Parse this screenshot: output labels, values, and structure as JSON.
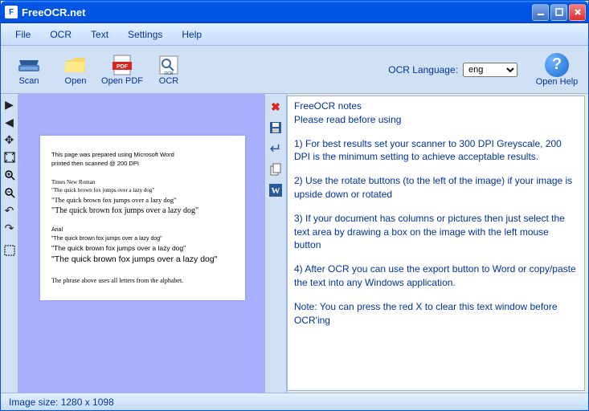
{
  "window": {
    "title": "FreeOCR.net"
  },
  "menu": {
    "file": "File",
    "ocr": "OCR",
    "text": "Text",
    "settings": "Settings",
    "help": "Help"
  },
  "toolbar": {
    "scan": "Scan",
    "open": "Open",
    "open_pdf": "Open PDF",
    "ocr": "OCR"
  },
  "lang": {
    "label": "OCR Language:",
    "selected": "eng",
    "options": [
      "eng"
    ]
  },
  "help_btn": "Open Help",
  "notes": {
    "title": "FreeOCR notes",
    "subtitle": "Please read before using",
    "p1": "1) For best results set your scanner to 300 DPI Greyscale, 200 DPI is the minimum setting to achieve acceptable results.",
    "p2": "2) Use the rotate buttons (to the left of the image) if your image is upside down or rotated",
    "p3": "3) If your document has columns or pictures then just select the text area by drawing a box on the image with the left mouse button",
    "p4": "4) After OCR you can use the export button to Word or copy/paste the text into any Windows application.",
    "note": "Note: You can press the red X to clear this text window before OCR'ing"
  },
  "doc": {
    "h1": "This page was prepared using Microsoft Word",
    "h2": "printed then scanned @ 200 DPI",
    "f1": "Times New Roman",
    "l1": "\"The quick brown fox jumps over a lazy dog\"",
    "l2": "\"The quick brown fox jumps over a lazy dog\"",
    "l3": "\"The quick brown fox jumps over a lazy dog\"",
    "f2": "Arial",
    "l4": "\"The quick brown fox jumps over a lazy dog\"",
    "l5": "\"The quick brown fox  jumps over a lazy dog\"",
    "l6": "\"The quick brown fox jumps over a lazy dog\"",
    "footer": "The phrase above uses all letters from the alphabet."
  },
  "status": "Image size:  1280 x  1098"
}
